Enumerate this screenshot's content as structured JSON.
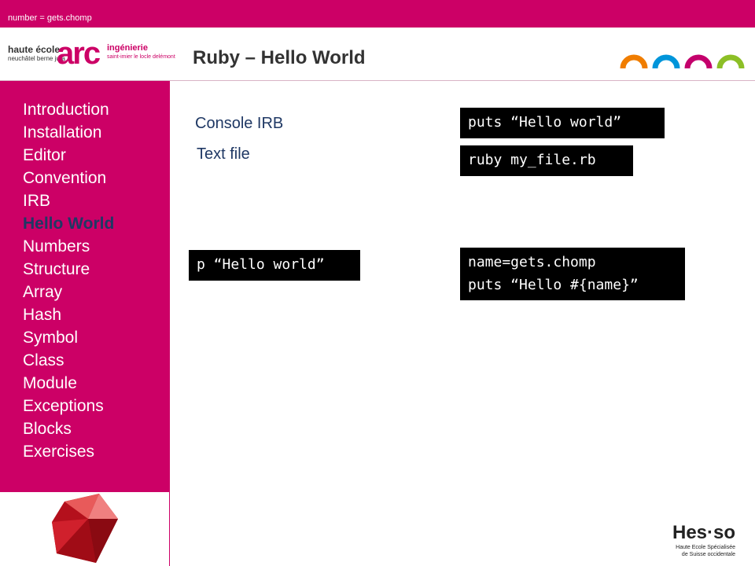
{
  "header": {
    "top_text": "number = gets.chomp",
    "title": "Ruby – Hello World"
  },
  "logo": {
    "left_line1": "haute école",
    "left_line2": "neuchâtel berne jura",
    "mark": "arc",
    "right_line1": "ingénierie",
    "right_line2": "saint-imier le locle delémont"
  },
  "nav": {
    "items": [
      {
        "label": "Introduction"
      },
      {
        "label": "Installation"
      },
      {
        "label": "Editor"
      },
      {
        "label": "Convention"
      },
      {
        "label": "IRB"
      },
      {
        "label": "Hello World",
        "active": true
      },
      {
        "label": "Numbers"
      },
      {
        "label": "Structure"
      },
      {
        "label": "Array"
      },
      {
        "label": "Hash"
      },
      {
        "label": "Symbol"
      },
      {
        "label": "Class"
      },
      {
        "label": "Module"
      },
      {
        "label": "Exceptions"
      },
      {
        "label": "Blocks"
      },
      {
        "label": "Exercises"
      }
    ]
  },
  "content": {
    "label_console": "Console IRB",
    "label_file": "Text file",
    "code_puts": "puts “Hello world”",
    "code_ruby": "ruby my_file.rb",
    "code_p": "p “Hello world”",
    "code_gets": "name=gets.chomp\nputs “Hello #{name}”"
  },
  "footer": {
    "hesso": "Hes·so",
    "hesso_sub1": "Haute Ecole Spécialisée",
    "hesso_sub2": "de Suisse occidentale"
  },
  "colors": {
    "accent": "#cc0066",
    "nav_active": "#1f3864",
    "arcs": [
      "#f07d00",
      "#0095da",
      "#c4006c",
      "#8cbf26"
    ]
  },
  "icons": {
    "ruby": "ruby-gem-icon",
    "arcs": "arc-decoration-icon"
  }
}
